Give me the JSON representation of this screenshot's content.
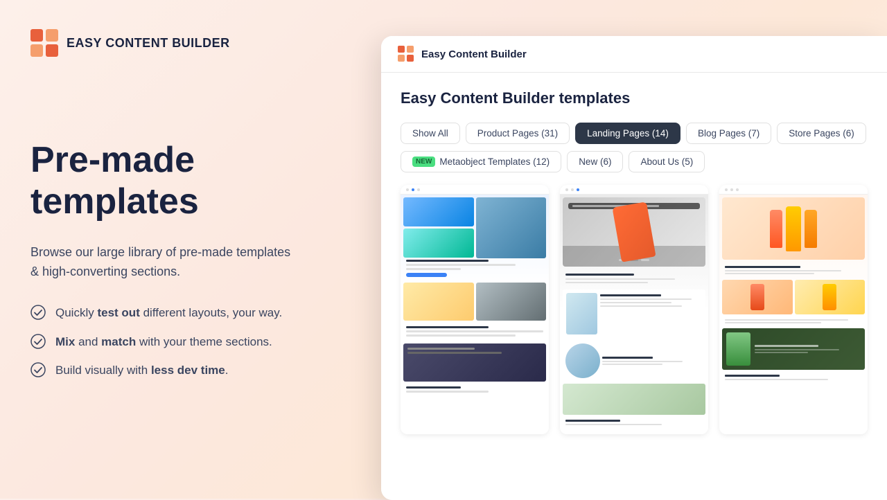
{
  "app": {
    "name": "Easy Content Builder",
    "logo_alt": "Easy Content Builder logo"
  },
  "header": {
    "logo_text": "EASY CONTENT BUILDER",
    "app_window_title": "Easy Content Builder"
  },
  "hero": {
    "title": "Pre-made templates",
    "subtitle": "Browse our large library of pre-made templates & high-converting sections.",
    "features": [
      {
        "id": 1,
        "text_normal": "Quickly ",
        "text_bold": "test out",
        "text_after": " different layouts, your way."
      },
      {
        "id": 2,
        "text_bold1": "Mix",
        "text_middle": " and ",
        "text_bold2": "match",
        "text_after": " with your theme sections."
      },
      {
        "id": 3,
        "text_normal": "Build visually with ",
        "text_bold": "less dev time",
        "text_after": "."
      }
    ]
  },
  "templates_panel": {
    "title": "Easy Content Builder templates",
    "filters": {
      "row1": [
        {
          "id": "show-all",
          "label": "Show All",
          "active": false
        },
        {
          "id": "product-pages",
          "label": "Product Pages (31)",
          "active": false
        },
        {
          "id": "landing-pages",
          "label": "Landing Pages (14)",
          "active": true
        },
        {
          "id": "blog-pages",
          "label": "Blog Pages (7)",
          "active": false
        },
        {
          "id": "store-pages",
          "label": "Store Pages (6)",
          "active": false
        }
      ],
      "row2": [
        {
          "id": "metaobject",
          "label": "Metaobject Templates (12)",
          "active": false,
          "new": true
        },
        {
          "id": "new",
          "label": "New (6)",
          "active": false
        },
        {
          "id": "about-us",
          "label": "About Us (5)",
          "active": false
        }
      ]
    },
    "cards": [
      {
        "id": 1,
        "type": "landing-hiking",
        "alt": "Hiking landing page template"
      },
      {
        "id": 2,
        "type": "product-mug",
        "alt": "Stainless steel travel mug product page"
      },
      {
        "id": 3,
        "type": "product-supplements",
        "alt": "Supplements product page template"
      }
    ]
  },
  "icons": {
    "check": "✓",
    "logo_squares": "▪"
  }
}
